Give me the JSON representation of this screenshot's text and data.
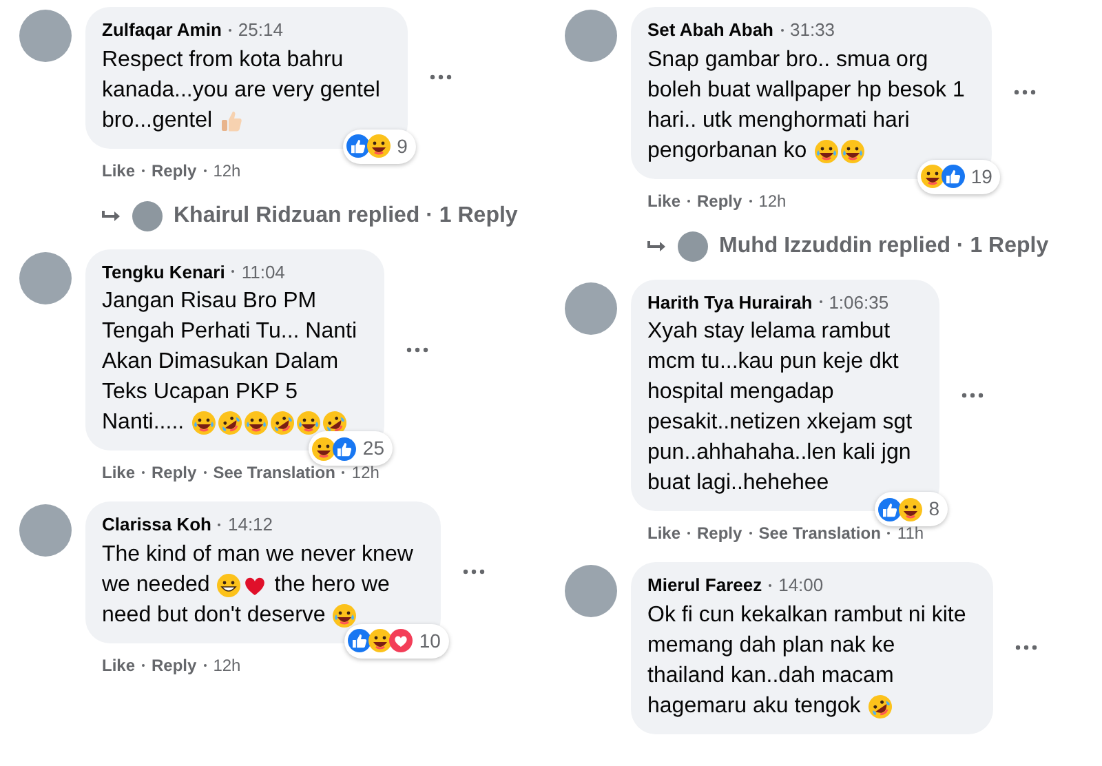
{
  "columns": [
    {
      "comments": [
        {
          "name": "Zulfaqar Amin",
          "time": "25:14",
          "body": [
            [
              {
                "kind": "text",
                "text": "Respect from kota bahru"
              }
            ],
            [
              {
                "kind": "text",
                "text": "kanada...you are very gentel"
              }
            ],
            [
              {
                "kind": "text",
                "text": "bro...gentel"
              },
              {
                "kind": "thumbs_up"
              }
            ]
          ],
          "reactions": {
            "icons": [
              {
                "kind": "like"
              },
              {
                "kind": "haha"
              }
            ],
            "count": "9"
          },
          "actions": [
            {
              "kind": "link",
              "text": "Like"
            },
            {
              "kind": "link",
              "text": "Reply"
            },
            {
              "kind": "time",
              "text": "12h"
            }
          ],
          "replies": {
            "text": "Khairul Ridzuan replied · 1 Reply"
          }
        },
        {
          "name": "Tengku Kenari",
          "time": "11:04",
          "body": [
            [
              {
                "kind": "text",
                "text": "Jangan Risau Bro PM"
              }
            ],
            [
              {
                "kind": "text",
                "text": "Tengah Perhati Tu... Nanti"
              }
            ],
            [
              {
                "kind": "text",
                "text": "Akan Dimasukan Dalam"
              }
            ],
            [
              {
                "kind": "text",
                "text": "Teks Ucapan PKP 5"
              }
            ],
            [
              {
                "kind": "text",
                "text": "Nanti....."
              },
              {
                "kind": "tears_of_joy"
              },
              {
                "kind": "rofl"
              },
              {
                "kind": "tears_of_joy"
              },
              {
                "kind": "rofl"
              },
              {
                "kind": "tears_of_joy"
              },
              {
                "kind": "rofl"
              }
            ]
          ],
          "reactions": {
            "icons": [
              {
                "kind": "haha"
              },
              {
                "kind": "like"
              }
            ],
            "count": "25"
          },
          "actions": [
            {
              "kind": "link",
              "text": "Like"
            },
            {
              "kind": "link",
              "text": "Reply"
            },
            {
              "kind": "link",
              "text": "See Translation"
            },
            {
              "kind": "time",
              "text": "12h"
            }
          ]
        },
        {
          "name": "Clarissa Koh",
          "time": "14:12",
          "body": [
            [
              {
                "kind": "text",
                "text": "The kind of man we never knew"
              }
            ],
            [
              {
                "kind": "text",
                "text": "we needed"
              },
              {
                "kind": "grin"
              },
              {
                "kind": "heart"
              },
              {
                "kind": "text",
                "text": "the hero we"
              }
            ],
            [
              {
                "kind": "text",
                "text": "need but don't deserve"
              },
              {
                "kind": "tears_of_joy"
              }
            ]
          ],
          "reactions": {
            "icons": [
              {
                "kind": "like"
              },
              {
                "kind": "haha"
              },
              {
                "kind": "love"
              }
            ],
            "count": "10"
          },
          "actions": [
            {
              "kind": "link",
              "text": "Like"
            },
            {
              "kind": "link",
              "text": "Reply"
            },
            {
              "kind": "time",
              "text": "12h"
            }
          ]
        }
      ]
    },
    {
      "comments": [
        {
          "name": "Set Abah Abah",
          "time": "31:33",
          "body": [
            [
              {
                "kind": "text",
                "text": "Snap gambar bro.. smua org"
              }
            ],
            [
              {
                "kind": "text",
                "text": "boleh buat wallpaper hp besok 1"
              }
            ],
            [
              {
                "kind": "text",
                "text": "hari.. utk menghormati hari"
              }
            ],
            [
              {
                "kind": "text",
                "text": "pengorbanan ko"
              },
              {
                "kind": "tears_of_joy"
              },
              {
                "kind": "tears_of_joy"
              }
            ]
          ],
          "reactions": {
            "icons": [
              {
                "kind": "haha"
              },
              {
                "kind": "like"
              }
            ],
            "count": "19"
          },
          "actions": [
            {
              "kind": "link",
              "text": "Like"
            },
            {
              "kind": "link",
              "text": "Reply"
            },
            {
              "kind": "time",
              "text": "12h"
            }
          ],
          "replies": {
            "text": "Muhd Izzuddin replied · 1 Reply"
          }
        },
        {
          "name": "Harith Tya Hurairah",
          "time": "1:06:35",
          "body": [
            [
              {
                "kind": "text",
                "text": "Xyah stay lelama rambut"
              }
            ],
            [
              {
                "kind": "text",
                "text": "mcm tu...kau pun keje dkt"
              }
            ],
            [
              {
                "kind": "text",
                "text": "hospital mengadap"
              }
            ],
            [
              {
                "kind": "text",
                "text": "pesakit..netizen xkejam sgt"
              }
            ],
            [
              {
                "kind": "text",
                "text": "pun..ahhahaha..len kali jgn"
              }
            ],
            [
              {
                "kind": "text",
                "text": "buat lagi..hehehee"
              }
            ]
          ],
          "reactions": {
            "icons": [
              {
                "kind": "like"
              },
              {
                "kind": "haha"
              }
            ],
            "count": "8"
          },
          "actions": [
            {
              "kind": "link",
              "text": "Like"
            },
            {
              "kind": "link",
              "text": "Reply"
            },
            {
              "kind": "link",
              "text": "See Translation"
            },
            {
              "kind": "time",
              "text": "11h"
            }
          ]
        },
        {
          "name": "Mierul Fareez",
          "time": "14:00",
          "body": [
            [
              {
                "kind": "text",
                "text": "Ok fi cun kekalkan rambut ni kite"
              }
            ],
            [
              {
                "kind": "text",
                "text": "memang dah plan nak ke"
              }
            ],
            [
              {
                "kind": "text",
                "text": "thailand kan..dah macam"
              }
            ],
            [
              {
                "kind": "text",
                "text": "hagemaru aku tengok"
              },
              {
                "kind": "rofl"
              }
            ]
          ]
        }
      ]
    }
  ]
}
